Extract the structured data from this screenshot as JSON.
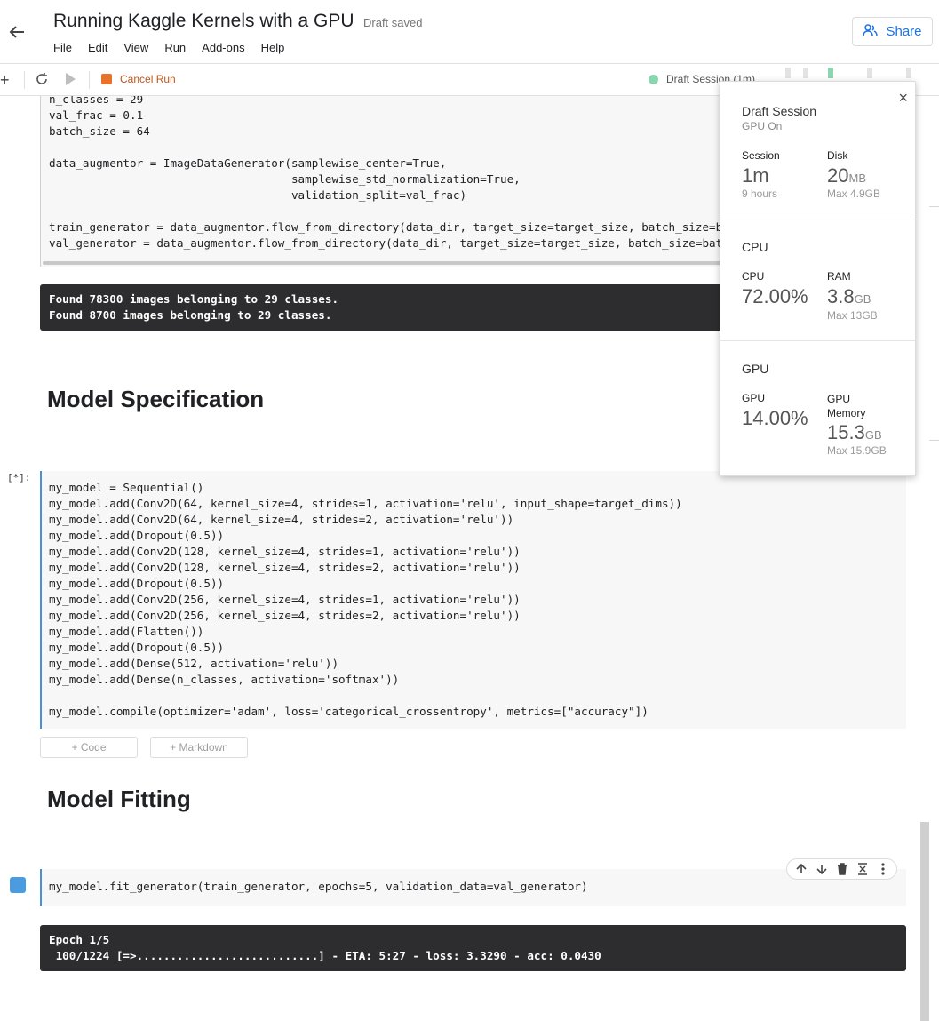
{
  "header": {
    "title": "Running Kaggle Kernels with a GPU",
    "status": "Draft saved",
    "menu": [
      "File",
      "Edit",
      "View",
      "Run",
      "Add-ons",
      "Help"
    ],
    "share_label": "Share"
  },
  "toolbar": {
    "cancel_label": "Cancel Run",
    "session_label": "Draft Session (1m)",
    "mini_labels": [
      "H",
      "D",
      "C",
      "P",
      "R",
      "A",
      "G",
      "P"
    ]
  },
  "cells": {
    "cell1_code": [
      "n_classes = 29",
      "val_frac = 0.1",
      "batch_size = 64",
      "",
      "data_augmentor = ImageDataGenerator(samplewise_center=True,",
      "                                    samplewise_std_normalization=True,",
      "                                    validation_split=val_frac)",
      "",
      "train_generator = data_augmentor.flow_from_directory(data_dir, target_size=target_size, batch_size=batch_size, shuffle=True, subset=\"training\")",
      "val_generator = data_augmentor.flow_from_directory(data_dir, target_size=target_size, batch_size=batch_size, subset=\"validation\")"
    ],
    "output1": [
      "Found 78300 images belonging to 29 classes.",
      "Found 8700 images belonging to 29 classes."
    ],
    "heading1": "Model Specification",
    "prompt": "[*]:",
    "cell2_code": [
      "my_model = Sequential()",
      "my_model.add(Conv2D(64, kernel_size=4, strides=1, activation='relu', input_shape=target_dims))",
      "my_model.add(Conv2D(64, kernel_size=4, strides=2, activation='relu'))",
      "my_model.add(Dropout(0.5))",
      "my_model.add(Conv2D(128, kernel_size=4, strides=1, activation='relu'))",
      "my_model.add(Conv2D(128, kernel_size=4, strides=2, activation='relu'))",
      "my_model.add(Dropout(0.5))",
      "my_model.add(Conv2D(256, kernel_size=4, strides=1, activation='relu'))",
      "my_model.add(Conv2D(256, kernel_size=4, strides=2, activation='relu'))",
      "my_model.add(Flatten())",
      "my_model.add(Dropout(0.5))",
      "my_model.add(Dense(512, activation='relu'))",
      "my_model.add(Dense(n_classes, activation='softmax'))",
      "",
      "my_model.compile(optimizer='adam', loss='categorical_crossentropy', metrics=[\"accuracy\"])"
    ],
    "add_code_label": "+ Code",
    "add_markdown_label": "+ Markdown",
    "heading2": "Model Fitting",
    "cell3_code": [
      "my_model.fit_generator(train_generator, epochs=5, validation_data=val_generator)"
    ],
    "output2": [
      "Epoch 1/5",
      " 100/1224 [=>...........................] - ETA: 5:27 - loss: 3.3290 - acc: 0.0430"
    ]
  },
  "session_popup": {
    "title": "Draft Session",
    "subtitle": "GPU On",
    "session_label": "Session",
    "session_value": "1m",
    "session_limit": "9 hours",
    "disk_label": "Disk",
    "disk_value": "20",
    "disk_unit": "MB",
    "disk_max": "Max 4.9GB",
    "cpu_section": "CPU",
    "cpu_label": "CPU",
    "cpu_value": "72.00%",
    "ram_label": "RAM",
    "ram_value": "3.8",
    "ram_unit": "GB",
    "ram_max": "Max 13GB",
    "gpu_section": "GPU",
    "gpu_label": "GPU",
    "gpu_value": "14.00%",
    "gpu_mem_label": "GPU Memory",
    "gpu_mem_value": "15.3",
    "gpu_mem_unit": "GB",
    "gpu_mem_max": "Max 15.9GB"
  },
  "colors": {
    "accent": "#1a73e8",
    "cancel": "#e8712b",
    "session_dot": "#8bd5b0",
    "output_bg": "#2d2d2f",
    "cell_border_active": "#4b8fd6"
  },
  "icons": [
    "back-arrow-icon",
    "people-icon",
    "plus-icon",
    "refresh-icon",
    "play-icon",
    "stop-icon",
    "close-icon",
    "arrow-up-icon",
    "arrow-down-icon",
    "trash-icon",
    "collapse-icon",
    "more-vertical-icon"
  ]
}
